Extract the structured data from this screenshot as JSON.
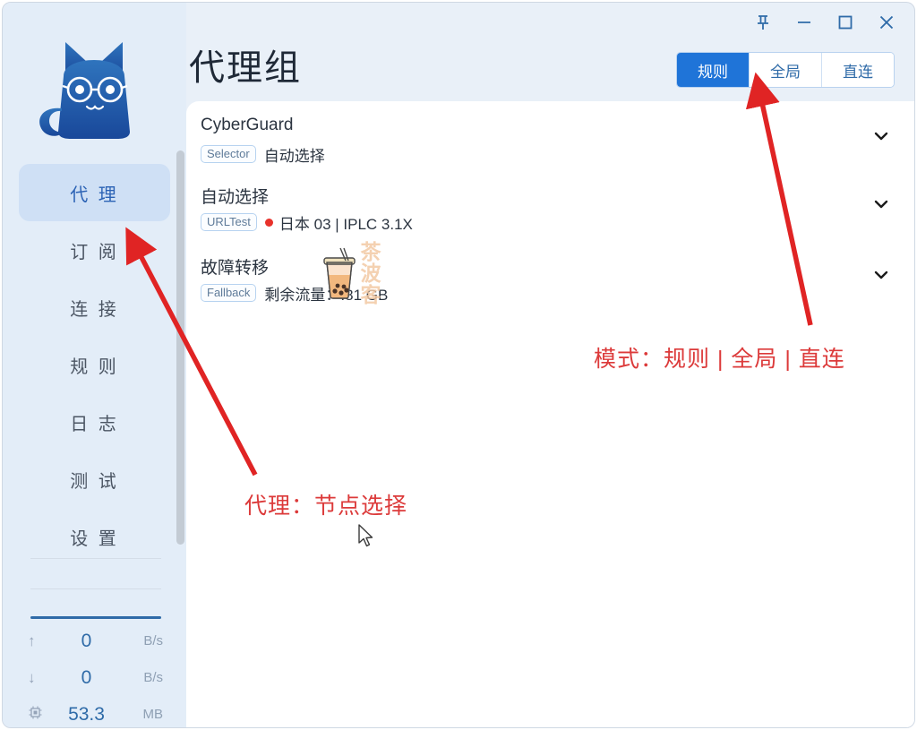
{
  "window": {
    "controls": [
      {
        "name": "pin-icon",
        "label": "置顶"
      },
      {
        "name": "minimize-icon",
        "label": "最小化"
      },
      {
        "name": "maximize-icon",
        "label": "最大化"
      },
      {
        "name": "close-icon",
        "label": "关闭"
      }
    ]
  },
  "header": {
    "title": "代理组"
  },
  "mode_switch": {
    "options": [
      {
        "label": "规则",
        "active": true
      },
      {
        "label": "全局",
        "active": false
      },
      {
        "label": "直连",
        "active": false
      }
    ]
  },
  "sidebar": {
    "logo_icon": "cat-logo-icon",
    "items": [
      {
        "label": "代 理",
        "active": true
      },
      {
        "label": "订 阅",
        "active": false
      },
      {
        "label": "连 接",
        "active": false
      },
      {
        "label": "规 则",
        "active": false
      },
      {
        "label": "日 志",
        "active": false
      },
      {
        "label": "测 试",
        "active": false
      },
      {
        "label": "设 置",
        "active": false
      }
    ],
    "stats": [
      {
        "icon": "upload-arrow-icon",
        "glyph": "↑",
        "value": "0",
        "unit": "B/s"
      },
      {
        "icon": "download-arrow-icon",
        "glyph": "↓",
        "value": "0",
        "unit": "B/s"
      },
      {
        "icon": "memory-chip-icon",
        "glyph": "⎔",
        "value": "53.3",
        "unit": "MB"
      }
    ]
  },
  "main": {
    "groups": [
      {
        "title": "CyberGuard",
        "badge": "Selector",
        "selection": "自动选择",
        "dot": false,
        "chevron": "chevron-down-icon"
      },
      {
        "title": "自动选择",
        "badge": "URLTest",
        "selection": "日本 03 | IPLC 3.1X",
        "dot": true,
        "dot_color": "#e8322b",
        "chevron": "chevron-down-icon"
      },
      {
        "title": "故障转移",
        "badge": "Fallback",
        "selection": "剩余流量：.81 GB",
        "dot": false,
        "chevron": "chevron-down-icon"
      }
    ],
    "sticker_icon": "bubble-tea-icon",
    "watermark": "茶波客"
  },
  "annotations": [
    {
      "text": "模式：规则 | 全局 | 直连",
      "color": "#dc3a3a"
    },
    {
      "text": "代理：节点选择",
      "color": "#dc3a3a"
    }
  ],
  "colors": {
    "accent": "#1f74d8",
    "sidebar_bg": "#e3edf8",
    "nav_active_bg": "#cfe0f5",
    "annotation_red": "#dc3a3a",
    "status_dot_red": "#e8322b"
  }
}
